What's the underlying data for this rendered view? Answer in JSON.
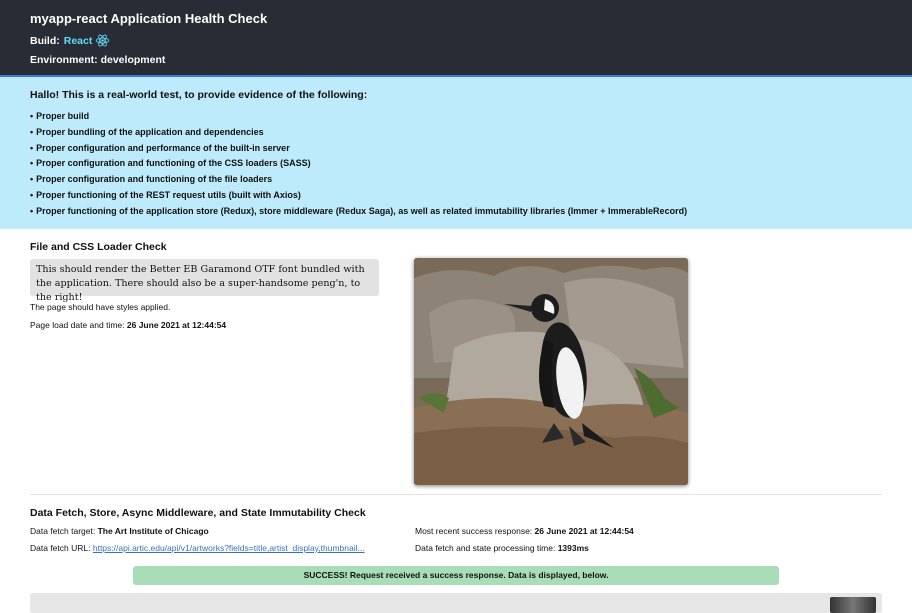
{
  "header": {
    "title": "myapp-react Application Health Check",
    "build_label": "Build:",
    "build_value": "React",
    "environment": "Environment: development",
    "react_icon": "react-atom-icon"
  },
  "info": {
    "heading": "Hallo! This is a real-world test, to provide evidence of the following:",
    "items": [
      "Proper build",
      "Proper bundling of the application and dependencies",
      "Proper configuration and performance of the built-in server",
      "Proper configuration and functioning of the CSS loaders (SASS)",
      "Proper configuration and functioning of the file loaders",
      "Proper functioning of the REST request utils (built with Axios)",
      "Proper functioning of the application store (Redux), store middleware (Redux Saga), as well as related immutability libraries (Immer + ImmerableRecord)"
    ]
  },
  "file_check": {
    "heading": "File and CSS Loader Check",
    "garamond_text": "This should render the Better EB Garamond OTF font bundled with the application. There should also be a super-handsome peng'n, to the right!",
    "styles_note": "The page should have styles applied.",
    "load_label": "Page load date and time:",
    "load_value": "26 June 2021 at 12:44:54",
    "image_icon": "penguin-photo"
  },
  "data_check": {
    "heading": "Data Fetch, Store, Async Middleware, and State Immutability Check",
    "target_label": "Data fetch target:",
    "target_value": "The Art Institute of Chicago",
    "url_label": "Data fetch URL:",
    "url_value": "https://api.artic.edu/api/v1/artworks?fields=title,artist_display,thumbnail...",
    "recent_label": "Most recent success response:",
    "recent_value": "26 June 2021 at 12:44:54",
    "processing_label": "Data fetch and state processing time:",
    "processing_value": "1393ms",
    "success_message": "SUCCESS! Request received a success response. Data is displayed, below."
  },
  "colors": {
    "header_bg": "#282c34",
    "react_accent": "#61dafb",
    "info_bg": "#bdebfb",
    "success_bg": "#a9ddb7",
    "link": "#3b6fc4"
  }
}
